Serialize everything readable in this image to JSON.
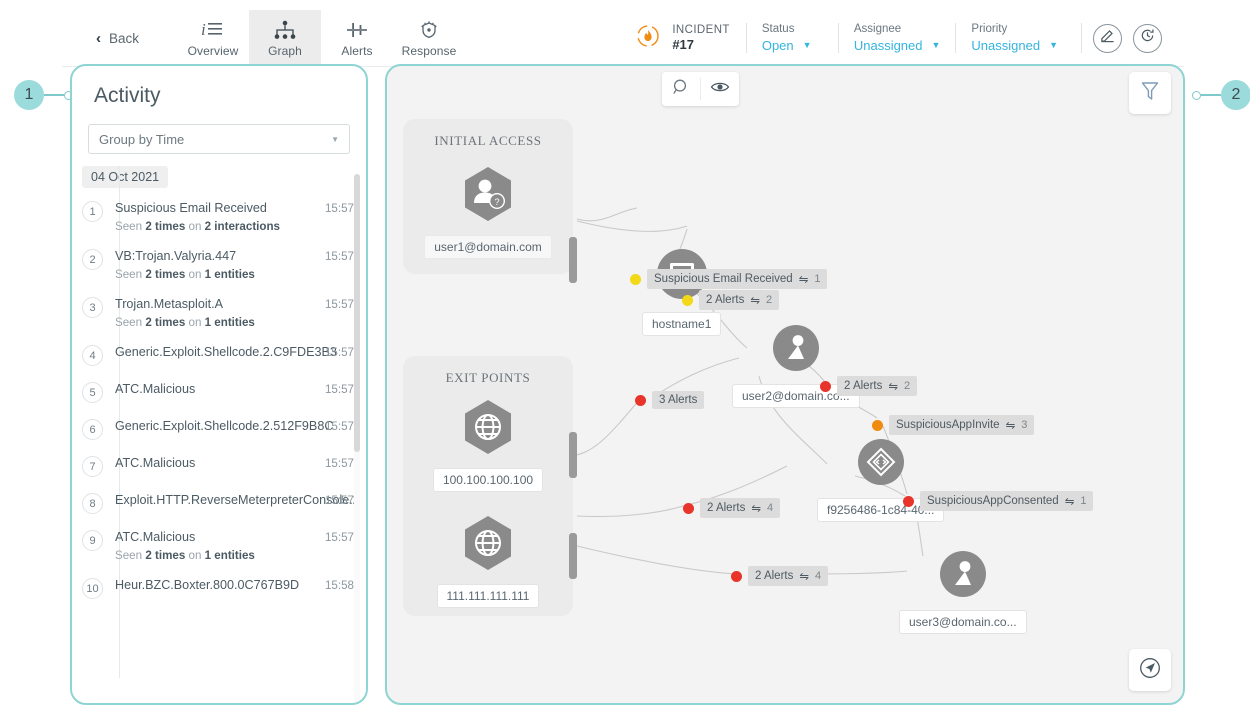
{
  "header": {
    "back_label": "Back",
    "tabs": [
      {
        "label": "Overview",
        "icon": "info-list-icon",
        "active": false
      },
      {
        "label": "Graph",
        "icon": "graph-nodes-icon",
        "active": true
      },
      {
        "label": "Alerts",
        "icon": "alerts-icon",
        "active": false
      },
      {
        "label": "Response",
        "icon": "shield-response-icon",
        "active": false
      }
    ],
    "incident": {
      "label": "INCIDENT",
      "number": "#17",
      "icon": "flame-target-icon"
    },
    "fields": [
      {
        "label": "Status",
        "value": "Open"
      },
      {
        "label": "Assignee",
        "value": "Unassigned"
      },
      {
        "label": "Priority",
        "value": "Unassigned"
      }
    ],
    "actions": [
      {
        "name": "edit-icon"
      },
      {
        "name": "history-icon"
      }
    ]
  },
  "callouts": [
    {
      "number": "1",
      "side": "left"
    },
    {
      "number": "2",
      "side": "right"
    }
  ],
  "activity": {
    "title": "Activity",
    "group_select": {
      "value": "Group by Time",
      "placeholder": "Group by Time"
    },
    "date_group": "04 Oct 2021",
    "items": [
      {
        "n": "1",
        "name": "Suspicious Email Received",
        "sub_pre": "Seen ",
        "sub_b1": "2 times",
        "sub_mid": " on ",
        "sub_b2": "2 interactions",
        "time": "15:57"
      },
      {
        "n": "2",
        "name": "VB:Trojan.Valyria.447",
        "sub_pre": "Seen ",
        "sub_b1": "2 times",
        "sub_mid": " on ",
        "sub_b2": "1 entities",
        "time": "15:57"
      },
      {
        "n": "3",
        "name": "Trojan.Metasploit.A",
        "sub_pre": "Seen ",
        "sub_b1": "2 times",
        "sub_mid": " on ",
        "sub_b2": "1 entities",
        "time": "15:57"
      },
      {
        "n": "4",
        "name": "Generic.Exploit.Shellcode.2.C9FDE3B3",
        "sub_pre": "",
        "sub_b1": "",
        "sub_mid": "",
        "sub_b2": "",
        "time": "15:57"
      },
      {
        "n": "5",
        "name": "ATC.Malicious",
        "sub_pre": "",
        "sub_b1": "",
        "sub_mid": "",
        "sub_b2": "",
        "time": "15:57"
      },
      {
        "n": "6",
        "name": "Generic.Exploit.Shellcode.2.512F9B8C",
        "sub_pre": "",
        "sub_b1": "",
        "sub_mid": "",
        "sub_b2": "",
        "time": "15:57"
      },
      {
        "n": "7",
        "name": "ATC.Malicious",
        "sub_pre": "",
        "sub_b1": "",
        "sub_mid": "",
        "sub_b2": "",
        "time": "15:57"
      },
      {
        "n": "8",
        "name": "Exploit.HTTP.ReverseMeterpreterConsole.2",
        "sub_pre": "",
        "sub_b1": "",
        "sub_mid": "",
        "sub_b2": "",
        "time": "15:57"
      },
      {
        "n": "9",
        "name": "ATC.Malicious",
        "sub_pre": "Seen ",
        "sub_b1": "2 times",
        "sub_mid": " on ",
        "sub_b2": "1 entities",
        "time": "15:57"
      },
      {
        "n": "10",
        "name": "Heur.BZC.Boxter.800.0C767B9D",
        "sub_pre": "",
        "sub_b1": "",
        "sub_mid": "",
        "sub_b2": "",
        "time": "15:58"
      }
    ]
  },
  "graph": {
    "toolbar": [
      {
        "name": "search-icon"
      },
      {
        "name": "eye-icon"
      }
    ],
    "filter_button": {
      "name": "filter-funnel-icon"
    },
    "locate_button": {
      "name": "navigate-icon"
    },
    "groups": [
      {
        "id": "initial-access",
        "title": "INITIAL ACCESS"
      },
      {
        "id": "exit-points",
        "title": "EXIT POINTS"
      }
    ],
    "nodes": [
      {
        "id": "user1",
        "label": "user1@domain.com",
        "icon": "user-unknown-hexagon-icon"
      },
      {
        "id": "host1",
        "label": "hostname1",
        "icon": "desktop-circle-icon"
      },
      {
        "id": "user2",
        "label": "user2@domain.co...",
        "icon": "user-circle-icon"
      },
      {
        "id": "appid",
        "label": "f9256486-1c84-40...",
        "icon": "application-circle-icon"
      },
      {
        "id": "user3",
        "label": "user3@domain.co...",
        "icon": "user-circle-icon"
      },
      {
        "id": "ip1",
        "label": "100.100.100.100",
        "icon": "globe-hexagon-icon"
      },
      {
        "id": "ip2",
        "label": "111.111.111.111",
        "icon": "globe-hexagon-icon"
      }
    ],
    "edge_labels": [
      {
        "id": "e1",
        "text": "Suspicious Email Received",
        "count": "1",
        "color": "#f2d817",
        "severity": "medium"
      },
      {
        "id": "e2",
        "text": "2 Alerts",
        "count": "2",
        "color": "#f2d817",
        "severity": "medium"
      },
      {
        "id": "e3",
        "text": "3 Alerts",
        "count": "",
        "color": "#e8342a",
        "severity": "high"
      },
      {
        "id": "e4",
        "text": "2 Alerts",
        "count": "2",
        "color": "#e8342a",
        "severity": "high"
      },
      {
        "id": "e5",
        "text": "SuspiciousAppInvite",
        "count": "3",
        "color": "#f08b12",
        "severity": "orange"
      },
      {
        "id": "e6",
        "text": "SuspiciousAppConsented",
        "count": "1",
        "color": "#e8342a",
        "severity": "high"
      },
      {
        "id": "e7",
        "text": "2 Alerts",
        "count": "4",
        "color": "#e8342a",
        "severity": "high"
      },
      {
        "id": "e8",
        "text": "2 Alerts",
        "count": "4",
        "color": "#e8342a",
        "severity": "high"
      }
    ],
    "swap_glyph": "⇋"
  },
  "colors": {
    "accent_teal": "#8ed4d2",
    "link_blue": "#35b4df",
    "node_gray": "#8a8a8a",
    "high": "#e8342a",
    "medium": "#f2d817",
    "orange": "#f08b12"
  }
}
